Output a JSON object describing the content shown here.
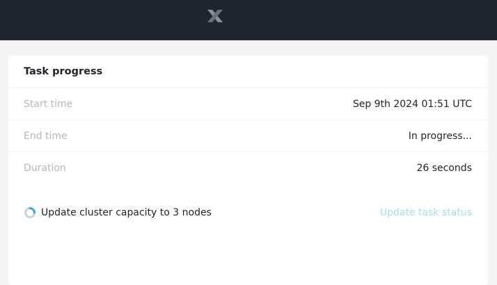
{
  "header": {
    "logo_icon": "nutanix-x-logo-icon",
    "background": "#1f2530"
  },
  "card": {
    "title": "Task progress",
    "rows": [
      {
        "label": "Start time",
        "value": "Sep 9th 2024 01:51 UTC"
      },
      {
        "label": "End time",
        "value": "In progress..."
      },
      {
        "label": "Duration",
        "value": "26 seconds"
      }
    ],
    "task": {
      "status_icon": "loading-spinner-icon",
      "label": "Update cluster capacity to 3 nodes",
      "action_label": "Update task status",
      "action_color": "#a6ddec"
    }
  }
}
